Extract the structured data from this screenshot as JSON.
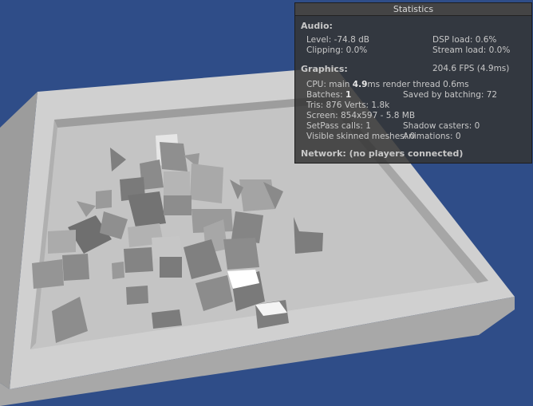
{
  "stats": {
    "title": "Statistics",
    "audio": {
      "header": "Audio:",
      "level": "Level: -74.8 dB",
      "dsp_load": "DSP load: 0.6%",
      "clipping": "Clipping: 0.0%",
      "stream_load": "Stream load: 0.0%"
    },
    "graphics": {
      "header": "Graphics:",
      "fps": "204.6 FPS (4.9ms)",
      "cpu_prefix": "CPU: main ",
      "cpu_main": "4.9",
      "cpu_suffix": "ms  render thread 0.6ms",
      "batches_prefix": "Batches: ",
      "batches": "1",
      "saved_by_batching": "Saved by batching: 72",
      "tris_verts": "Tris: 876  Verts: 1.8k",
      "screen": "Screen: 854x597 - 5.8 MB",
      "setpass": "SetPass calls: 1",
      "shadow_casters": "Shadow casters: 0",
      "skinned_meshes": "Visible skinned meshes: 0",
      "animations": "Animations: 0"
    },
    "network": "Network: (no players connected)"
  },
  "scene": {
    "background_color": "#2f4d88",
    "floor_color": "#bcbcbc",
    "wall_color": "#d6d6d6",
    "cube_color": "#8a8a8a"
  }
}
